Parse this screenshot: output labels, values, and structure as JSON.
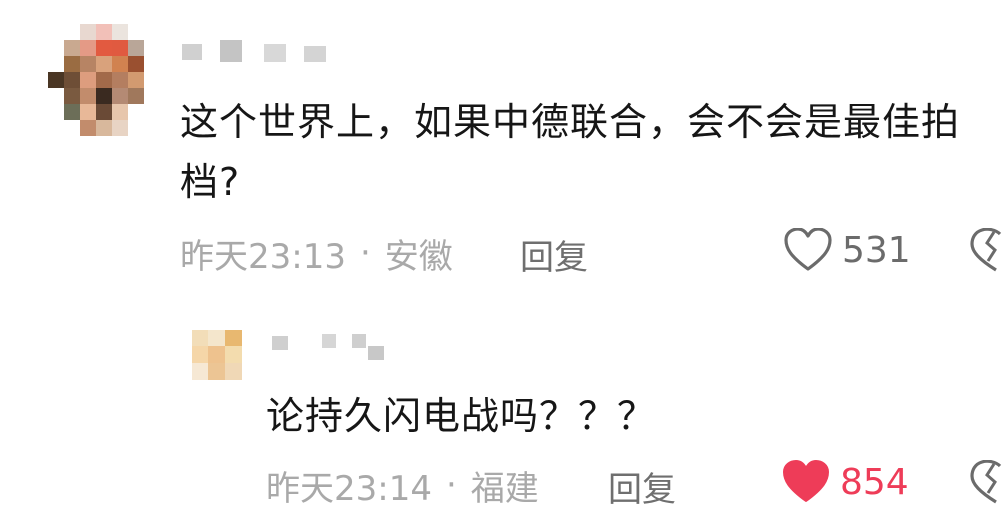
{
  "comments": [
    {
      "text": "这个世界上，如果中德联合，会不会是最佳拍档?",
      "time": "昨天23:13",
      "location": "安徽",
      "separator": "·",
      "reply_label": "回复",
      "likes": "531",
      "liked": false
    },
    {
      "text": "论持久闪电战吗？？？",
      "time": "昨天23:14",
      "location": "福建",
      "separator": "·",
      "reply_label": "回复",
      "likes": "854",
      "liked": true
    }
  ],
  "icons": {
    "like_icon": "heart-outline-icon",
    "liked_icon": "heart-filled-icon",
    "dislike_icon": "broken-heart-icon"
  },
  "colors": {
    "text": "#161616",
    "meta": "#a9a9a9",
    "reply_button": "#6f6f6f",
    "like_count": "#6b6b6b",
    "liked": "#ee3c58"
  }
}
